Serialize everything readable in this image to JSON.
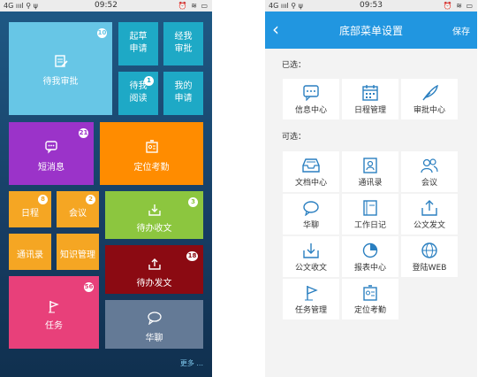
{
  "left_screen": {
    "status": {
      "network": "4G",
      "time": "09:52"
    },
    "tiles": [
      {
        "label": "待我审批",
        "badge": "10",
        "color": "#67c6e6"
      },
      {
        "label": "起草\n申请",
        "color": "#1ea9c6"
      },
      {
        "label": "经我\n审批",
        "color": "#1ea9c6"
      },
      {
        "label": "待我\n阅读",
        "badge": "1",
        "color": "#1ea9c6"
      },
      {
        "label": "我的\n申请",
        "color": "#1ea9c6"
      },
      {
        "label": "短消息",
        "badge": "21",
        "color": "#9b33c9"
      },
      {
        "label": "定位考勤",
        "color": "#ff8c00"
      },
      {
        "label": "日程",
        "badge": "8",
        "color": "#f5a623"
      },
      {
        "label": "会议",
        "badge": "2",
        "color": "#f5a623"
      },
      {
        "label": "待办收文",
        "badge": "3",
        "color": "#8cc63f"
      },
      {
        "label": "通讯录",
        "color": "#f5a623"
      },
      {
        "label": "知识管理",
        "color": "#f5a623"
      },
      {
        "label": "待办发文",
        "badge": "18",
        "color": "#8b0a12"
      },
      {
        "label": "任务",
        "badge": "56",
        "color": "#e8407a"
      },
      {
        "label": "华聊",
        "color": "#647a96"
      }
    ],
    "more_link": "更多 ..."
  },
  "right_screen": {
    "status": {
      "network": "4G",
      "time": "09:53"
    },
    "nav": {
      "back": "‹",
      "title": "底部菜单设置",
      "save": "保存"
    },
    "selected_heading": "已选：",
    "selected": [
      {
        "label": "信息中心",
        "icon": "chat-bubble-icon"
      },
      {
        "label": "日程管理",
        "icon": "calendar-icon"
      },
      {
        "label": "审批中心",
        "icon": "quill-icon"
      }
    ],
    "available_heading": "可选：",
    "available": [
      {
        "label": "文档中心",
        "icon": "inbox-icon"
      },
      {
        "label": "通讯录",
        "icon": "address-book-icon"
      },
      {
        "label": "会议",
        "icon": "people-icon"
      },
      {
        "label": "华聊",
        "icon": "chat-icon"
      },
      {
        "label": "工作日记",
        "icon": "notebook-icon"
      },
      {
        "label": "公文发文",
        "icon": "outbox-icon"
      },
      {
        "label": "公文收文",
        "icon": "download-tray-icon"
      },
      {
        "label": "报表中心",
        "icon": "chart-pie-icon"
      },
      {
        "label": "登陆WEB",
        "icon": "globe-icon"
      },
      {
        "label": "任务管理",
        "icon": "flag-icon"
      },
      {
        "label": "定位考勤",
        "icon": "id-badge-icon"
      }
    ],
    "accent_color": "#2196e0",
    "icon_color": "#2a7fc0"
  }
}
